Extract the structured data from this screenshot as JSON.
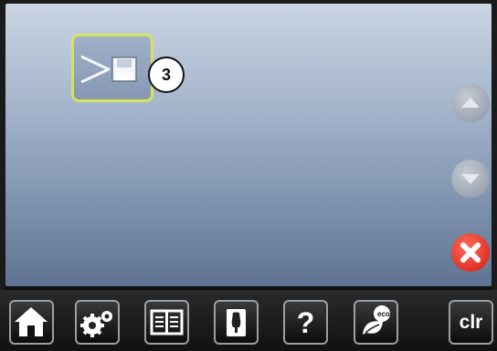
{
  "screen": {
    "thumbnail": {
      "icon": "stitch-save-icon",
      "selected_border_color": "#d6e35a"
    },
    "badge": {
      "number": "3"
    },
    "side_controls": {
      "scroll_up": "triangle-up-icon",
      "scroll_down": "triangle-down-icon",
      "close": "close-x-icon",
      "close_color": "#e0261a"
    }
  },
  "taskbar": {
    "home": "home-icon",
    "settings": "gears-icon",
    "book": "book-icon",
    "dress": "dress-form-icon",
    "help": {
      "icon": "question-icon",
      "label": "?"
    },
    "eco": {
      "icon": "eco-leaf-icon",
      "label": "eco"
    },
    "clr": {
      "label": "clr"
    }
  }
}
